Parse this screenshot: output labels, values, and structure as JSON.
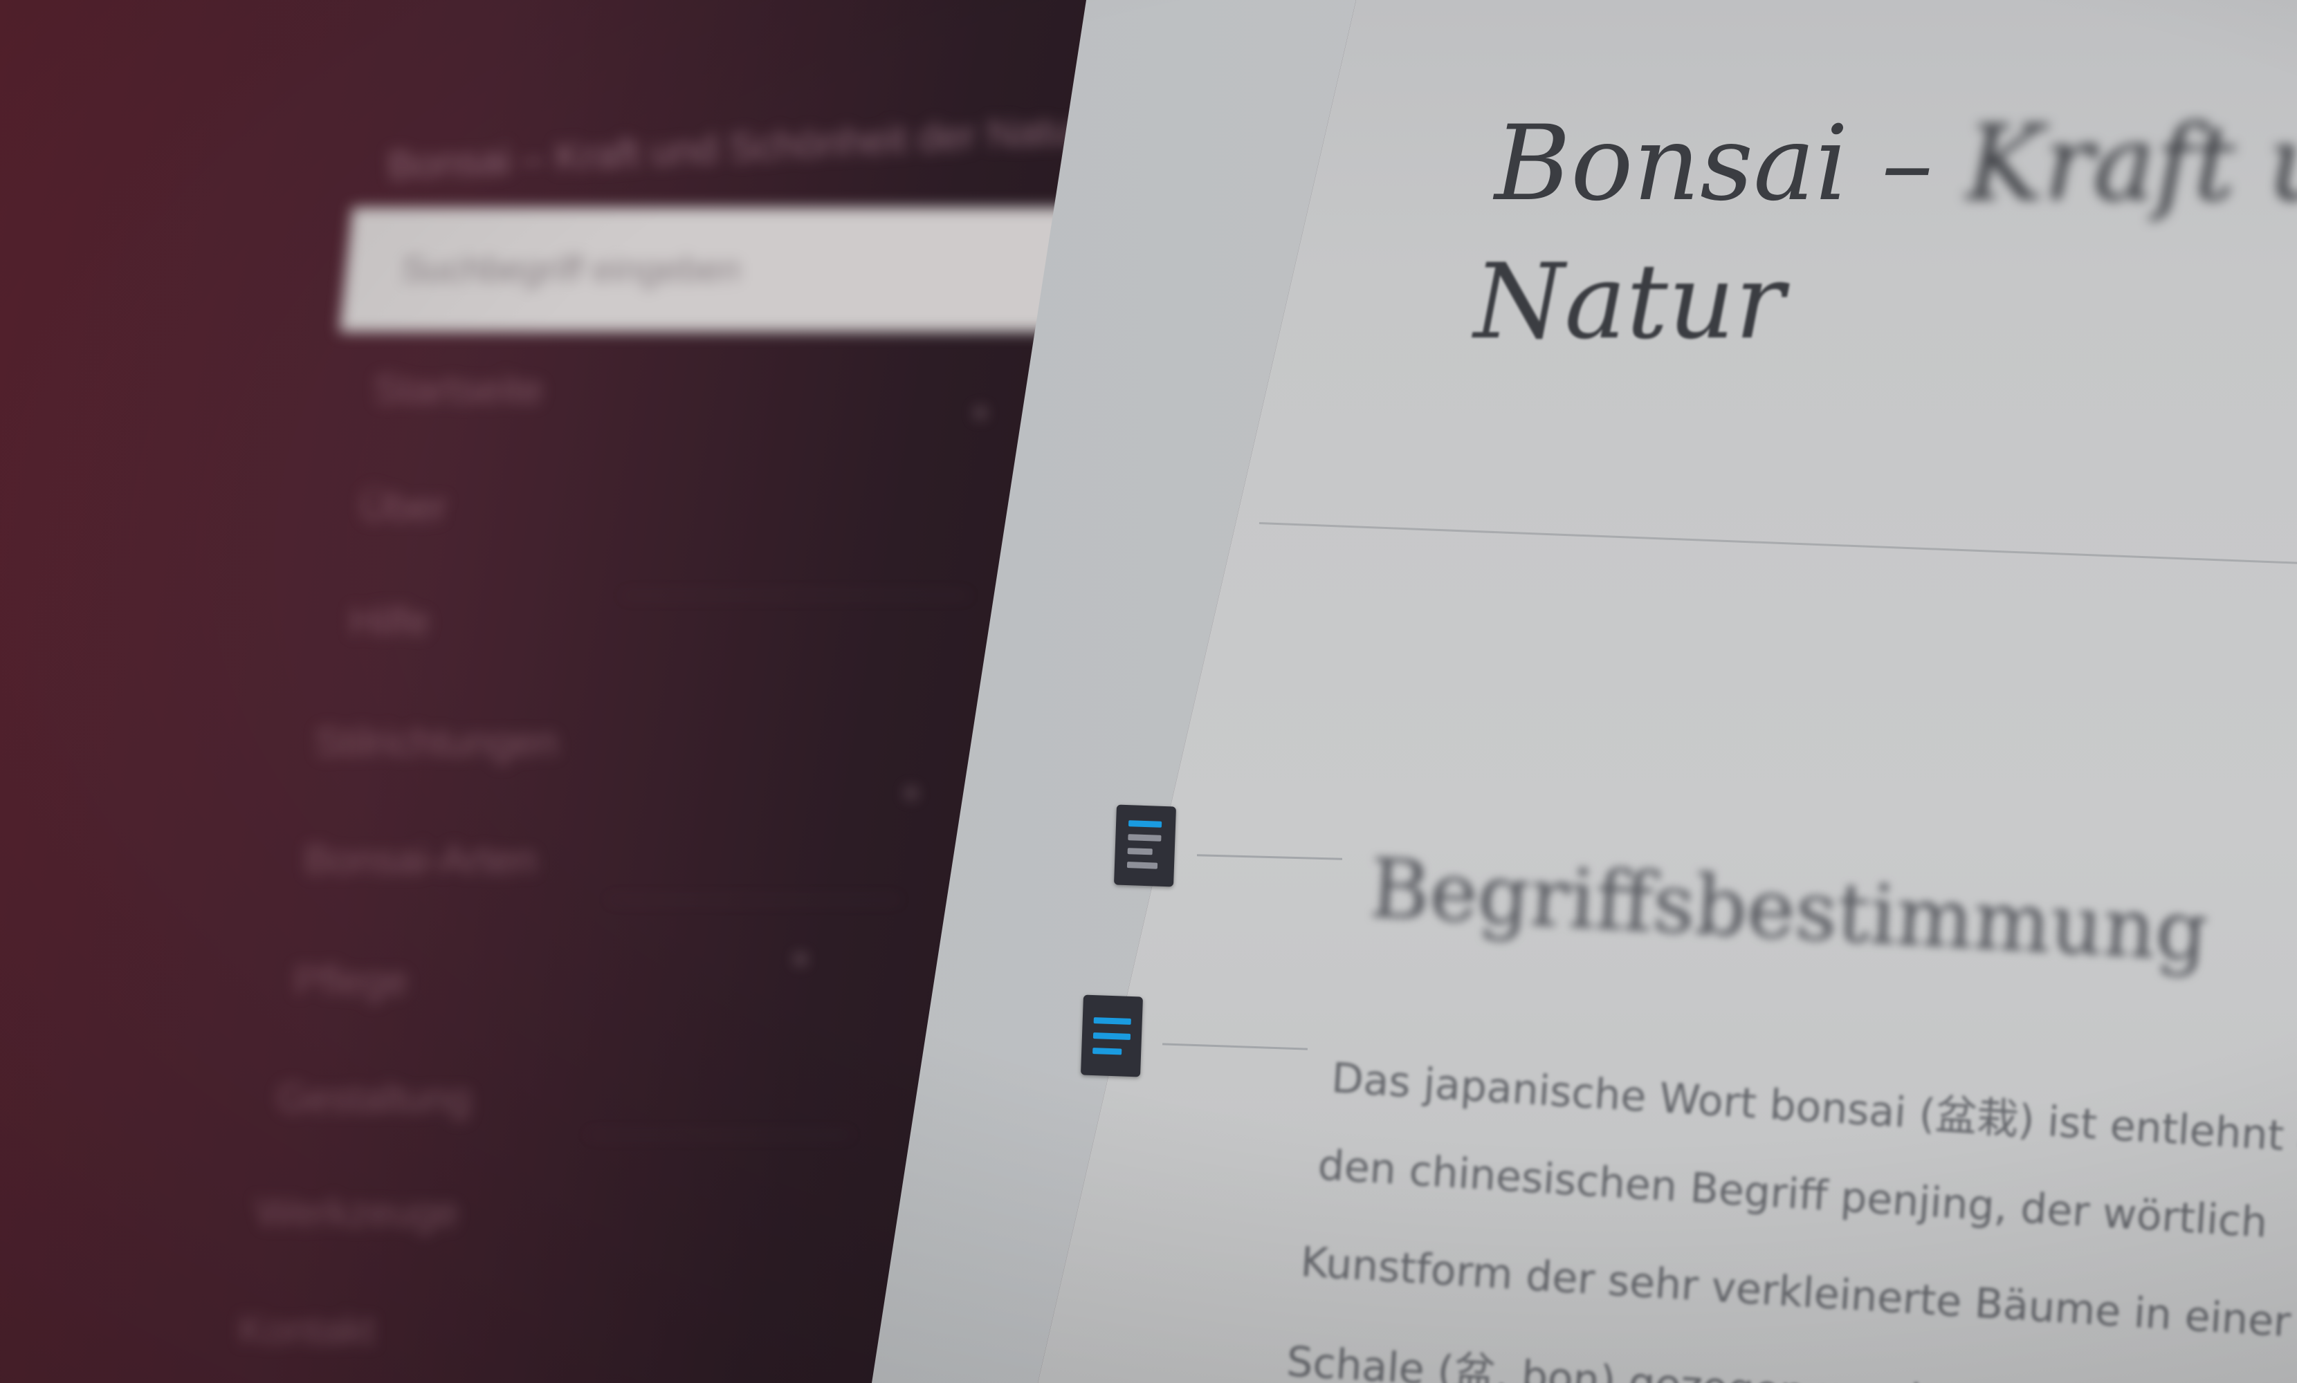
{
  "sidebar": {
    "subtitle": "Bonsai – Kraft und Schönheit der Natur",
    "search_placeholder": "Suchbegriff eingeben",
    "items": [
      {
        "label": "Startseite"
      },
      {
        "label": "Über"
      },
      {
        "label": "Hilfe"
      },
      {
        "label": "Stilrichtungen"
      },
      {
        "label": "Bonsai-Arten"
      },
      {
        "label": "Pflege"
      },
      {
        "label": "Gestaltung"
      },
      {
        "label": "Werkzeuge"
      },
      {
        "label": "Kontakt"
      }
    ]
  },
  "article": {
    "title_visible": "Bonsai –",
    "title_blurred": "Kraft und",
    "title_line2": "Natur",
    "section_heading": "Begriffsbestimmung",
    "body_lines": [
      "Das japanische Wort bonsai (盆栽) ist entlehnt aus",
      "den chinesischen Begriff penjing, der wörtlich",
      "Kunstform der sehr verkleinerte Bäume in einer",
      "Schale (盆, bon) gezogen werden"
    ]
  },
  "icons": [
    {
      "name": "document-icon",
      "accent": "#1a9be0"
    },
    {
      "name": "document-icon",
      "accent": "#1a9be0"
    }
  ],
  "colors": {
    "sidebar_bg": "#4a2431",
    "content_bg": "#c8c9ca",
    "title_text": "#3b3d42",
    "accent": "#1a9be0"
  }
}
